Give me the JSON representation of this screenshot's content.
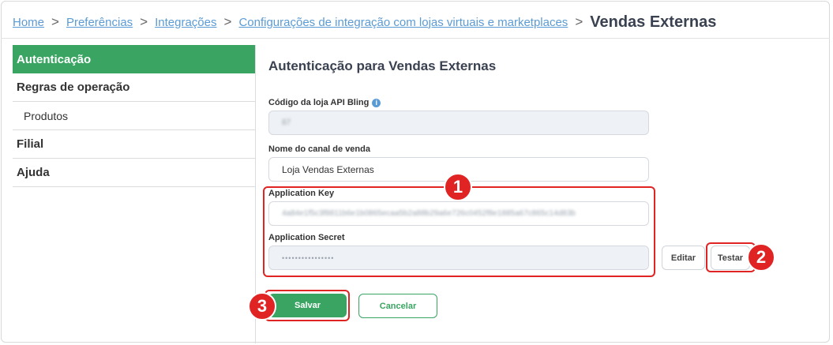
{
  "breadcrumb": {
    "items": [
      "Home",
      "Preferências",
      "Integrações",
      "Configurações de integração com lojas virtuais e marketplaces"
    ],
    "current": "Vendas Externas",
    "separator": ">"
  },
  "sidebar": {
    "items": [
      {
        "label": "Autenticação",
        "active": true
      },
      {
        "label": "Regras de operação"
      },
      {
        "label": "Produtos",
        "sub": true
      },
      {
        "label": "Filial"
      },
      {
        "label": "Ajuda"
      }
    ]
  },
  "form": {
    "title": "Autenticação para Vendas Externas",
    "store_code_label": "Código da loja API Bling",
    "store_code_value": "87",
    "channel_label": "Nome do canal de venda",
    "channel_value": "Loja Vendas Externas",
    "app_key_label": "Application Key",
    "app_key_value": "4a84e1f5c3f8811b6e1b0865ecaa5b2a88b29a6e726c0452f8e1885a67c865c14d83b",
    "app_secret_label": "Application Secret",
    "app_secret_value": "••••••••••••••••"
  },
  "buttons": {
    "edit": "Editar",
    "test": "Testar",
    "save": "Salvar",
    "cancel": "Cancelar"
  },
  "annotations": {
    "badge1": "1",
    "badge2": "2",
    "badge3": "3"
  },
  "colors": {
    "accent": "#3aa562",
    "link": "#5b9bd5",
    "highlight": "#e02424"
  }
}
